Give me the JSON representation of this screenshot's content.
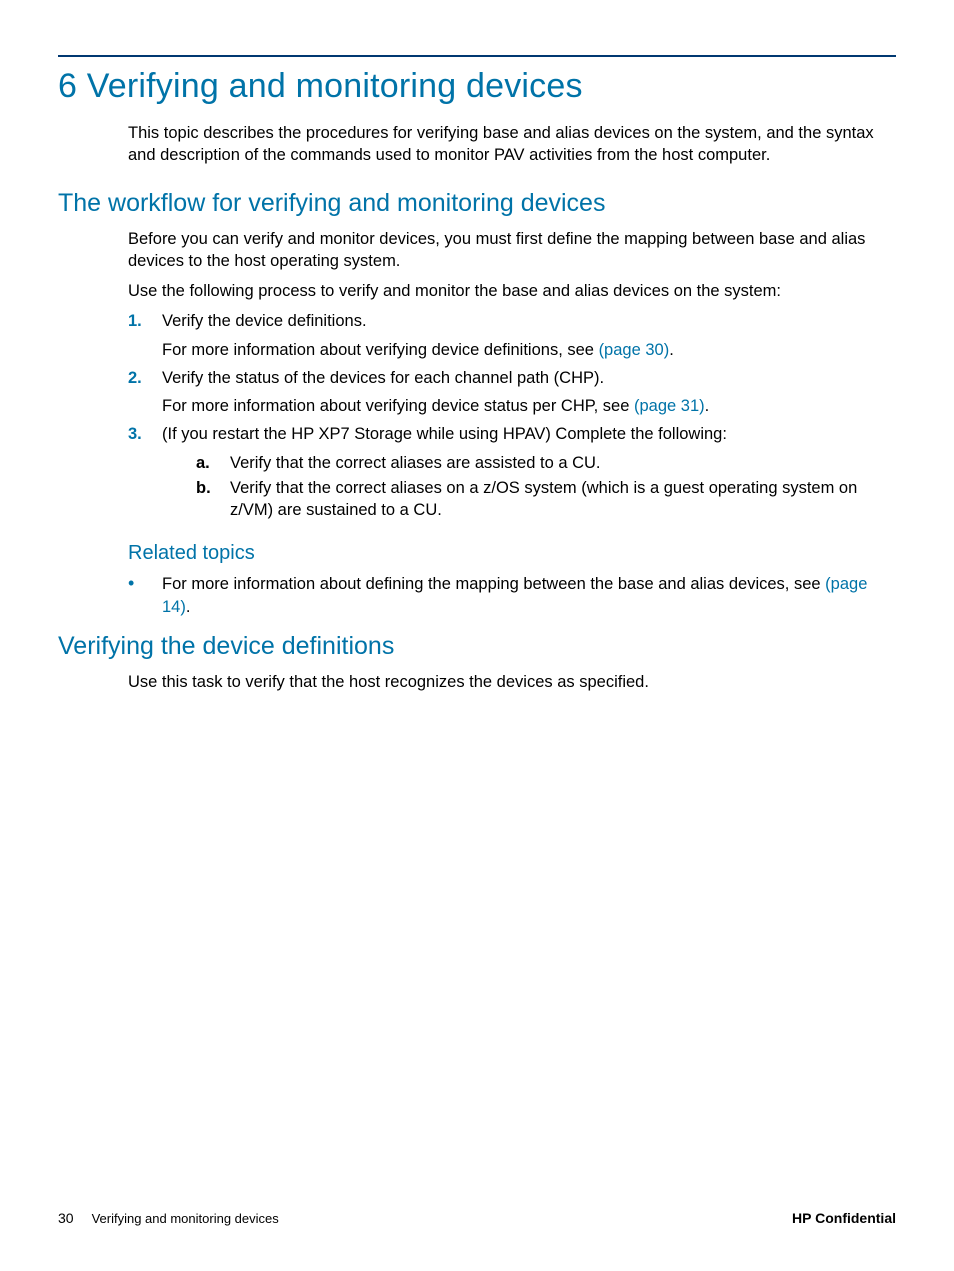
{
  "chapter_title": "6 Verifying and monitoring devices",
  "intro": "This topic describes the procedures for verifying base and alias devices on the system, and the syntax and description of the commands used to monitor PAV activities from the host computer.",
  "section1": {
    "title": "The workflow for verifying and monitoring devices",
    "p1": "Before you can verify and monitor devices, you must first define the mapping between base and alias devices to the host operating system.",
    "p2": "Use the following process to verify and monitor the base and alias devices on the system:",
    "steps": [
      {
        "marker": "1.",
        "text": "Verify the device definitions.",
        "followup_pre": "For more information about verifying device definitions, see ",
        "followup_link": "(page 30)",
        "followup_post": "."
      },
      {
        "marker": "2.",
        "text": "Verify the status of the devices for each channel path (CHP).",
        "followup_pre": "For more information about verifying device status per CHP, see ",
        "followup_link": "(page 31)",
        "followup_post": "."
      },
      {
        "marker": "3.",
        "text": "(If you restart the HP XP7 Storage while using HPAV) Complete the following:",
        "sub": [
          {
            "marker": "a.",
            "text": "Verify that the correct aliases are assisted to a CU."
          },
          {
            "marker": "b.",
            "text": "Verify that the correct aliases on a z/OS system (which is a guest operating system on z/VM) are sustained to a CU."
          }
        ]
      }
    ]
  },
  "related": {
    "title": "Related topics",
    "item_pre": "For more information about defining the mapping between the base and alias devices, see ",
    "item_link": "(page 14)",
    "item_post": "."
  },
  "section2": {
    "title": "Verifying the device definitions",
    "p1": "Use this task to verify that the host recognizes the devices as specified."
  },
  "footer": {
    "page": "30",
    "title": "Verifying and monitoring devices",
    "confidential": "HP Confidential"
  }
}
